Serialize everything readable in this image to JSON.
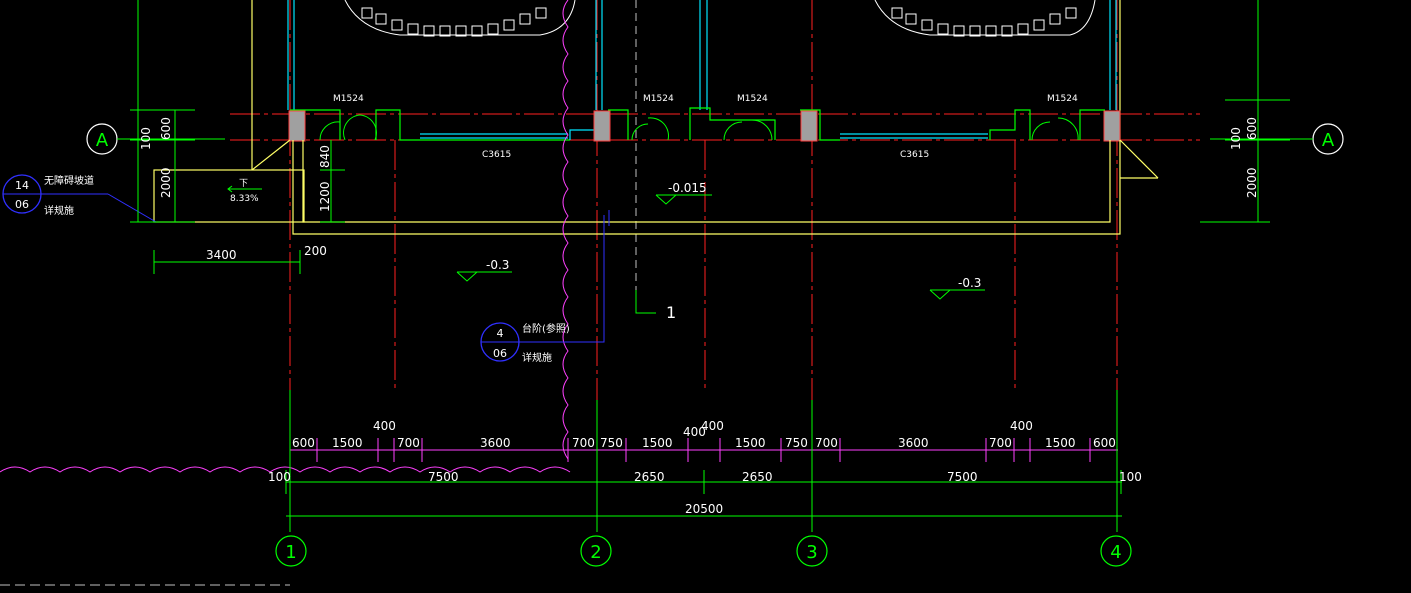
{
  "drawing": {
    "axes": {
      "row": "A",
      "cols": [
        "1",
        "2",
        "3",
        "4"
      ]
    },
    "door_labels": [
      "M1524",
      "M1524",
      "M1524",
      "M1524"
    ],
    "window_labels": [
      "C3615",
      "C3615"
    ],
    "elevations": {
      "interior": "-0.015",
      "exterior_left": "-0.3",
      "exterior_right": "-0.3"
    },
    "section_mark": "1",
    "ramp": {
      "arrow_text": "下",
      "slope": "8.33%"
    },
    "callouts": [
      {
        "top": "14",
        "bottom": "06",
        "title": "无障碍坡道",
        "sub": "详规施"
      },
      {
        "top": "4",
        "bottom": "06",
        "title": "台阶(参照)",
        "sub": "详规施"
      }
    ],
    "side_dims": {
      "left": [
        "600",
        "100",
        "2000"
      ],
      "inner": [
        "840",
        "1200"
      ],
      "right": [
        "600",
        "100",
        "2000"
      ]
    },
    "ramp_dims": [
      "3400",
      "200"
    ],
    "dim_row1": [
      "600",
      "1500",
      "700",
      "3600",
      "700",
      "750",
      "1500",
      "1500",
      "750",
      "700",
      "3600",
      "700",
      "1500",
      "600"
    ],
    "dim_row1_upper": [
      "400",
      "400",
      "400",
      "400"
    ],
    "dim_row2": [
      "100",
      "7500",
      "2650",
      "2650",
      "7500",
      "100"
    ],
    "dim_total": "20500"
  }
}
